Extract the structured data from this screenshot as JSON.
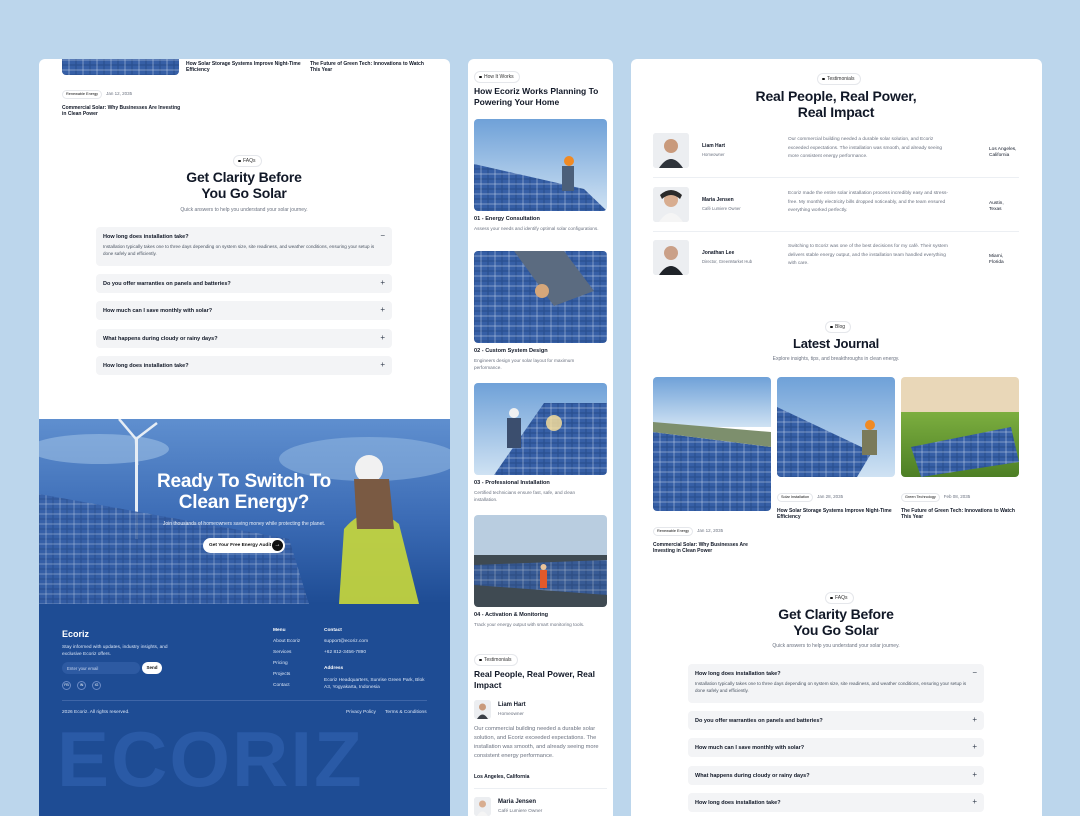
{
  "colors": {
    "background": "#bcd6ec",
    "footer_blue": "#1e4c94",
    "dark": "#111827",
    "faq_bg": "#f3f4f6"
  },
  "icons": {
    "plus": "+",
    "minus": "−",
    "arrow": "→"
  },
  "blog": {
    "posts": [
      {
        "tag": "Renewable Energy",
        "date": "Jan 12, 2035",
        "title": "Commercial Solar: Why Businesses Are Investing in Clean Power"
      },
      {
        "tag": "Solar Installation",
        "date": "Jan 28, 2035",
        "title": "How Solar Storage Systems Improve Night-Time Efficiency"
      },
      {
        "tag": "Green Technology",
        "date": "Feb 08, 2035",
        "title": "The Future of Green Tech: Innovations to Watch This Year"
      }
    ],
    "pill": "Blog",
    "title": "Latest Journal",
    "subtitle": "Explore insights, tips, and breakthroughs in clean energy."
  },
  "faq": {
    "pill": "FAQs",
    "title_line1": "Get Clarity Before",
    "title_line2": "You Go Solar",
    "subtitle": "Quick answers to help you understand your solar journey.",
    "items": [
      {
        "q": "How long does installation take?",
        "a": "Installation typically takes one to three days depending on system size, site readiness, and weather conditions, ensuring your setup is done safely and efficiently.",
        "open": true
      },
      {
        "q": "Do you offer warranties on panels and batteries?",
        "open": false
      },
      {
        "q": "How much can I save monthly with solar?",
        "open": false
      },
      {
        "q": "What happens during cloudy or rainy days?",
        "open": false
      },
      {
        "q": "How long does installation take?",
        "open": false
      }
    ]
  },
  "cta": {
    "title_line1": "Ready To Switch To",
    "title_line2": "Clean Energy?",
    "subtitle": "Join thousands of homeowners saving money while protecting the planet.",
    "button": "Get Your Free Energy Audit"
  },
  "footer": {
    "brand": "Ecoriz",
    "about": "Stay informed with updates, industry insights, and exclusive Ecoriz offers.",
    "email_placeholder": "Enter your email",
    "send": "Send",
    "socials": [
      "FB",
      "IN",
      "IG"
    ],
    "menu_title": "Menu",
    "menu": [
      "About Ecoriz",
      "Services",
      "Pricing",
      "Projects",
      "Contact"
    ],
    "contact_title": "Contact",
    "email": "support@ecoriz.com",
    "phone": "+62 812-3456-7890",
    "address_title": "Address",
    "address": "Ecoriz Headquarters, Sunrise Green Park, Blok A3, Yogyakarta, Indonesia",
    "copyright": "2026 Ecoriz. All rights reserved.",
    "privacy": "Privacy Policy",
    "terms": "Terms & Conditions",
    "watermark": "ECORIZ"
  },
  "how": {
    "pill": "How It Works",
    "title": "How Ecoriz Works Planning To Powering Your Home",
    "steps": [
      {
        "title": "01 - Energy Consultation",
        "desc": "Assess your needs and identify optimal solar configurations."
      },
      {
        "title": "02 - Custom System Design",
        "desc": "Engineers design your solar layout for maximum performance."
      },
      {
        "title": "03 - Professional Installation",
        "desc": "Certified technicians ensure fast, safe, and clean installation."
      },
      {
        "title": "04 - Activation & Monitoring",
        "desc": "Track your energy output with smart monitoring tools."
      }
    ]
  },
  "testimonials": {
    "pill": "Testimonials",
    "title_line1": "Real People, Real Power,",
    "title_line2": "Real Impact",
    "title_mobile": "Real People, Real Power, Real Impact",
    "items": [
      {
        "name": "Liam Hart",
        "role": "Homeowner",
        "quote": "Our commercial building needed a durable solar solution, and Ecoriz exceeded expectations. The installation was smooth, and already seeing more consistent energy performance.",
        "location": "Los Angeles, California",
        "loc1": "Los Angeles,",
        "loc2": "California",
        "quote_mobile": "Our commercial building needed a durable solar solution, and Ecoriz exceeded expectations. The installation was smooth, and already seeing more consistent energy performance."
      },
      {
        "name": "Maria Jensen",
        "role": "Café Lumiere Owner",
        "quote": "Ecoriz made the entire solar installation process incredibly easy and stress-free. My monthly electricity bills dropped noticeably, and the team ensured everything worked perfectly.",
        "loc1": "Austin,",
        "loc2": "Texas"
      },
      {
        "name": "Jonathan Lee",
        "role": "Director, GreenMarket Hub",
        "quote": "Switching to Ecoriz was one of the best decisions for my café. Their system delivers stable energy output, and the installation team handled everything with care.",
        "loc1": "Miami,",
        "loc2": "Florida"
      }
    ]
  }
}
